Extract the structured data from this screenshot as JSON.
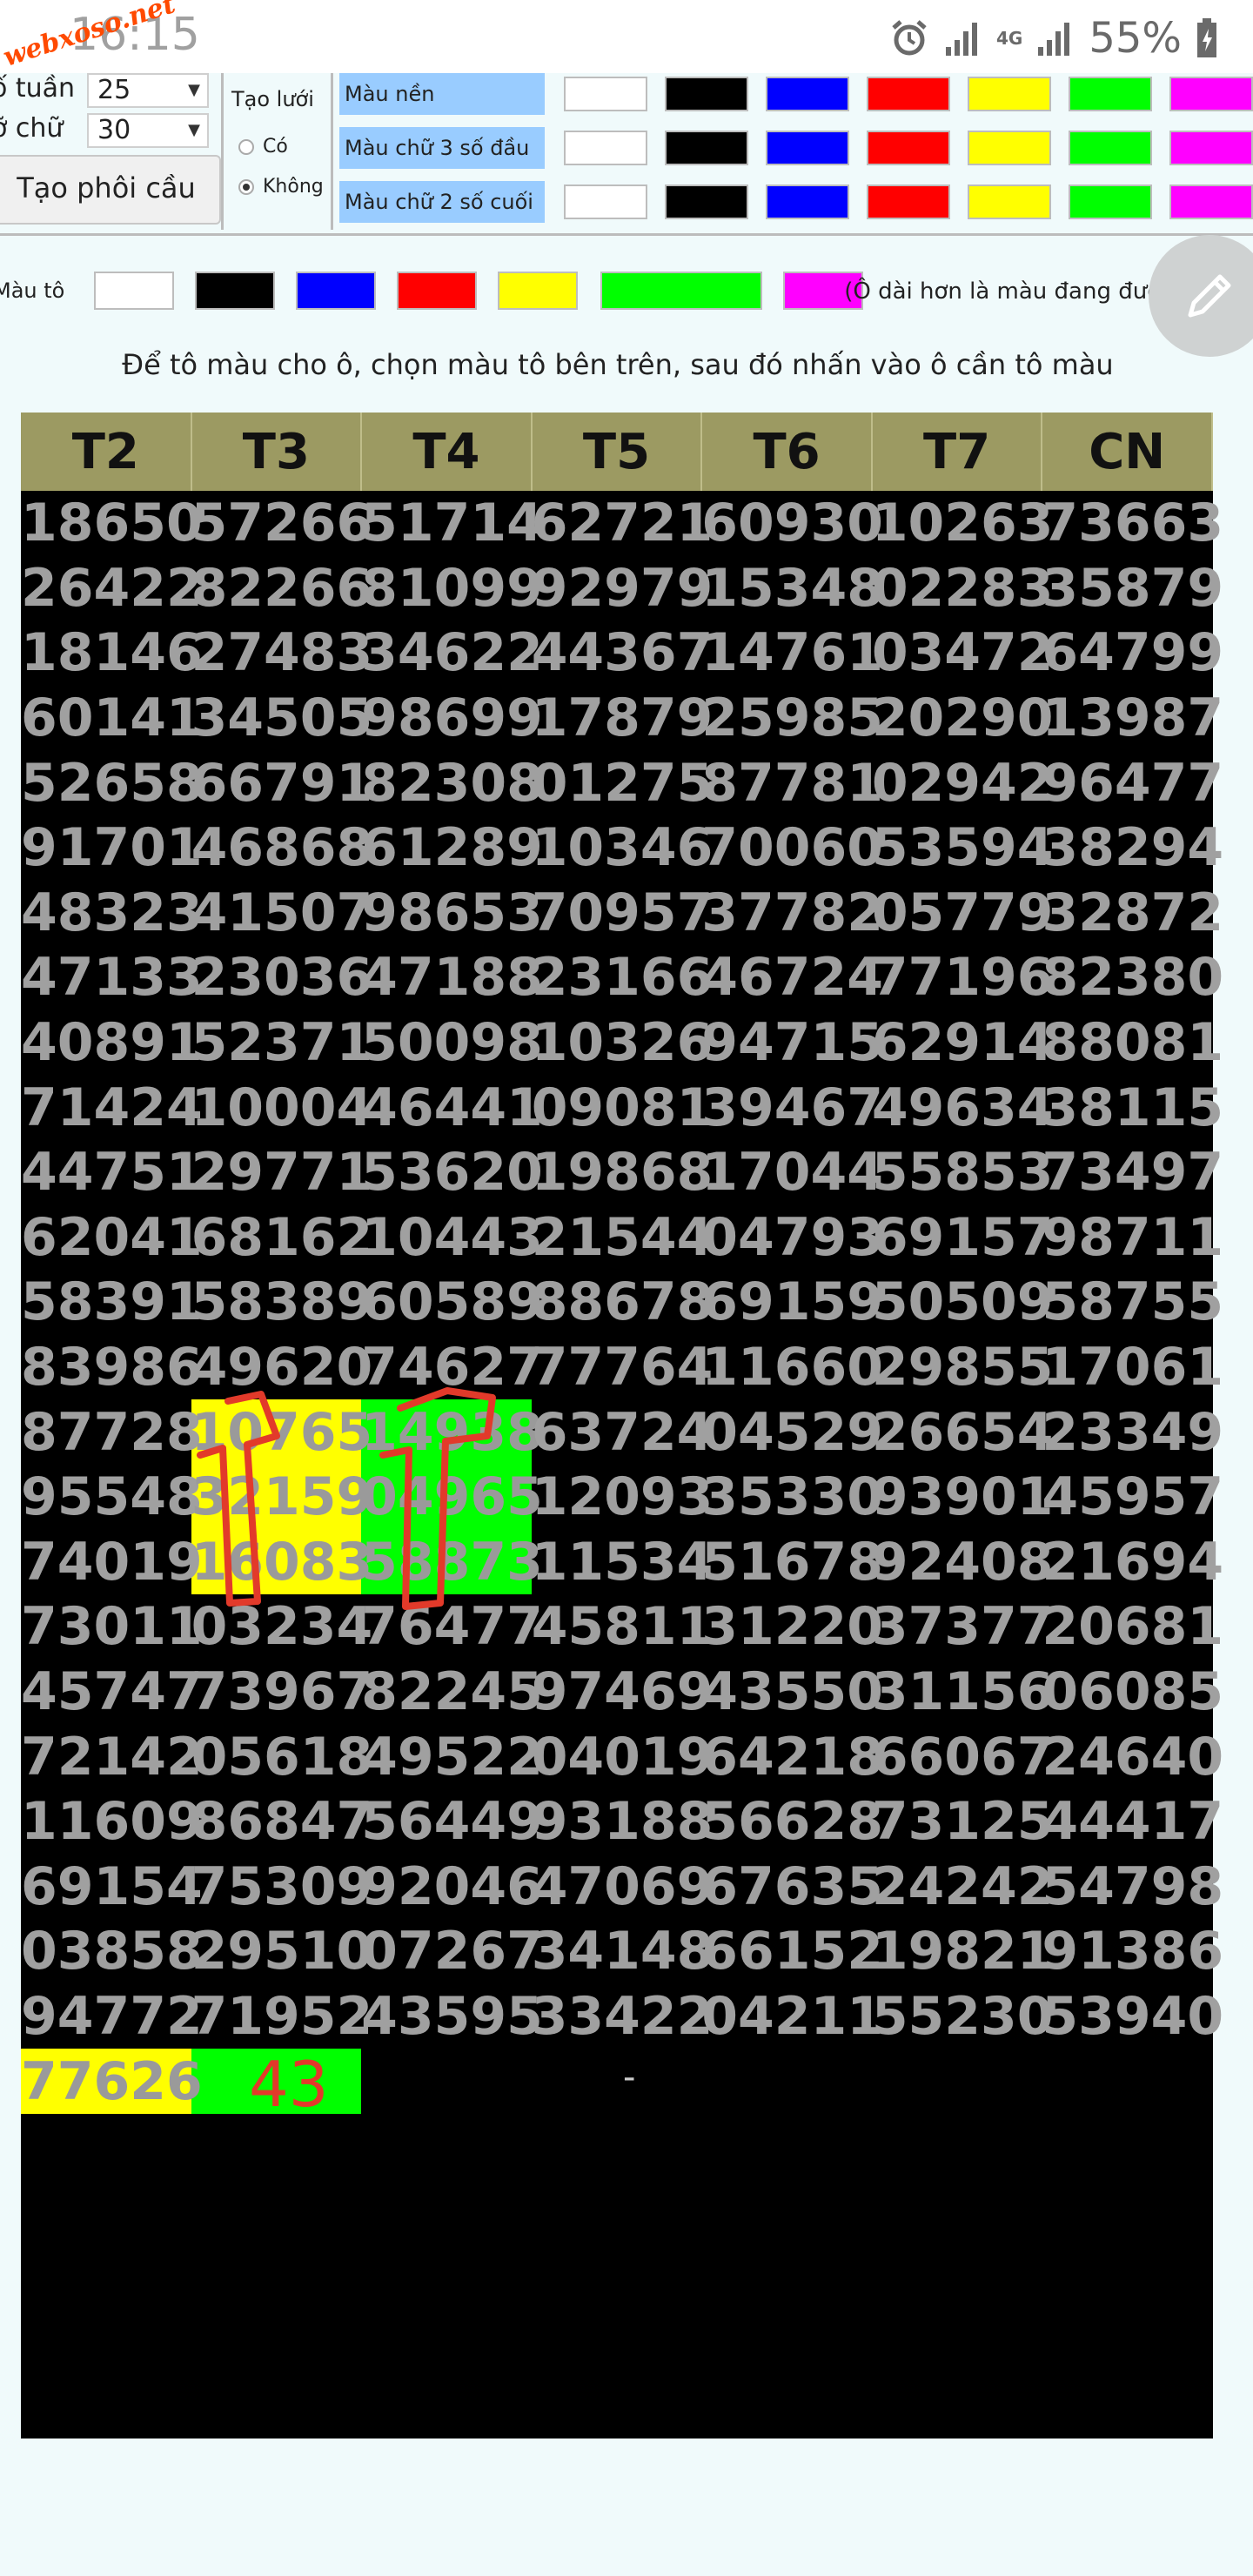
{
  "status": {
    "time": "16:15",
    "watermark": "webxoso.net",
    "network": "4G",
    "battery": "55%"
  },
  "controls": {
    "week_label": "ố tuần",
    "week_value": "25",
    "font_label": "ỡ chữ",
    "font_value": "30",
    "generate_button": "Tạo phôi cầu",
    "grid_label": "Tạo lưới",
    "grid_on": "Có",
    "grid_off": "Không",
    "rows": [
      {
        "label": "Màu nền"
      },
      {
        "label": "Màu chữ 3 số đầu"
      },
      {
        "label": "Màu chữ 2 số cuối"
      }
    ],
    "palette": [
      "#ffffff",
      "#000000",
      "#0000ff",
      "#ff0000",
      "#ffff00",
      "#00ff00",
      "#ff00ff"
    ],
    "paint_label": "Màu tô",
    "paint_note": "(Ô dài hơn là màu đang được chọn)"
  },
  "instruction": "Để tô màu cho ô, chọn màu tô bên trên, sau đó nhấn vào ô cần tô màu",
  "table": {
    "headers": [
      "T2",
      "T3",
      "T4",
      "T5",
      "T6",
      "T7",
      "CN"
    ],
    "rows": [
      [
        "18650",
        "57266",
        "51714",
        "62721",
        "60930",
        "10263",
        "73663"
      ],
      [
        "26422",
        "82266",
        "81099",
        "92979",
        "15348",
        "02283",
        "35879"
      ],
      [
        "18146",
        "27483",
        "34622",
        "44367",
        "14761",
        "03472",
        "64799"
      ],
      [
        "60141",
        "34505",
        "98699",
        "17879",
        "25985",
        "20290",
        "13987"
      ],
      [
        "52658",
        "66791",
        "82308",
        "01275",
        "87781",
        "02942",
        "96477"
      ],
      [
        "91701",
        "46868",
        "61289",
        "10346",
        "70060",
        "53594",
        "38294"
      ],
      [
        "48323",
        "41507",
        "98653",
        "70957",
        "37782",
        "05779",
        "32872"
      ],
      [
        "47133",
        "23036",
        "47188",
        "23166",
        "46724",
        "77196",
        "82380"
      ],
      [
        "40891",
        "52371",
        "50098",
        "10326",
        "94715",
        "62914",
        "88081"
      ],
      [
        "71424",
        "10004",
        "46441",
        "09081",
        "39467",
        "49634",
        "38115"
      ],
      [
        "44751",
        "29771",
        "53620",
        "19868",
        "17044",
        "55853",
        "73497"
      ],
      [
        "62041",
        "68162",
        "10443",
        "21544",
        "04793",
        "69157",
        "98711"
      ],
      [
        "58391",
        "58389",
        "60589",
        "88678",
        "69159",
        "50509",
        "58755"
      ],
      [
        "83986",
        "49620",
        "74627",
        "77764",
        "11660",
        "29855",
        "17061"
      ],
      [
        "87728",
        "10765",
        "14938",
        "63724",
        "04529",
        "26654",
        "23349"
      ],
      [
        "95548",
        "32159",
        "04965",
        "12093",
        "35330",
        "93901",
        "45957"
      ],
      [
        "74019",
        "16083",
        "58873",
        "11534",
        "51678",
        "92408",
        "21694"
      ],
      [
        "73011",
        "03234",
        "76477",
        "45811",
        "31220",
        "37377",
        "20681"
      ],
      [
        "45747",
        "73967",
        "82245",
        "97469",
        "43550",
        "31156",
        "06085"
      ],
      [
        "72142",
        "05618",
        "49522",
        "04019",
        "64218",
        "66067",
        "24640"
      ],
      [
        "11609",
        "86847",
        "56449",
        "93188",
        "56628",
        "73125",
        "44417"
      ],
      [
        "69154",
        "75309",
        "92046",
        "47069",
        "67635",
        "24242",
        "54798"
      ],
      [
        "03858",
        "29510",
        "07267",
        "34148",
        "66152",
        "19821",
        "91386"
      ],
      [
        "94772",
        "71952",
        "43595",
        "33422",
        "04211",
        "55230",
        "53940"
      ],
      [
        "77626",
        "",
        "",
        "",
        "",
        "",
        ""
      ]
    ],
    "highlight_yellow": [
      [
        14,
        1
      ],
      [
        15,
        1
      ],
      [
        16,
        1
      ],
      [
        24,
        0
      ]
    ],
    "highlight_green": [
      [
        14,
        2
      ],
      [
        15,
        2
      ],
      [
        16,
        2
      ],
      [
        24,
        1
      ]
    ],
    "annotation": "43",
    "dash": "-"
  }
}
